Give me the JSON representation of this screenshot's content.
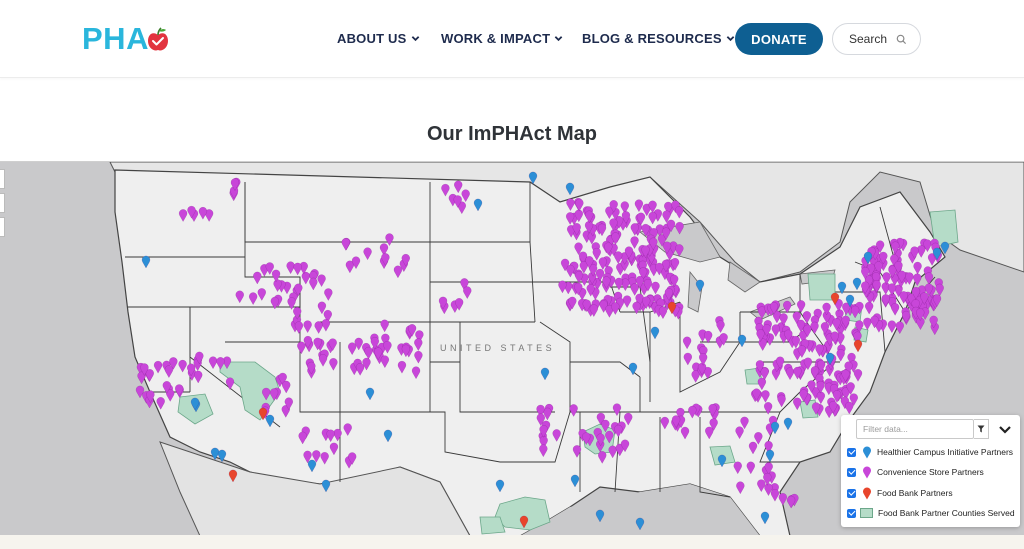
{
  "header": {
    "logo_text": "PHA",
    "nav": [
      {
        "label": "ABOUT US"
      },
      {
        "label": "WORK & IMPACT"
      },
      {
        "label": "BLOG & RESOURCES"
      }
    ],
    "donate_label": "DONATE",
    "search_label": "Search"
  },
  "page_title": "Our ImPHAct Map",
  "map": {
    "country_label": "UNITED STATES",
    "colors": {
      "healthier_campus": "#2c8fd6",
      "convenience_store": "#c846d9",
      "food_bank": "#e8452c",
      "county_fill": "#b5dcc8"
    }
  },
  "legend": {
    "filter_placeholder": "Filter data...",
    "items": [
      {
        "label": "Healthier Campus Initiative Partners",
        "icon": "blue-map-pin-icon",
        "checked": true
      },
      {
        "label": "Convenience Store Partners",
        "icon": "purple-map-pin-icon",
        "checked": true
      },
      {
        "label": "Food Bank Partners",
        "icon": "red-map-pin-icon",
        "checked": true
      },
      {
        "label": "Food Bank Partner Counties Served",
        "icon": "green-area-swatch-icon",
        "checked": true
      }
    ]
  }
}
